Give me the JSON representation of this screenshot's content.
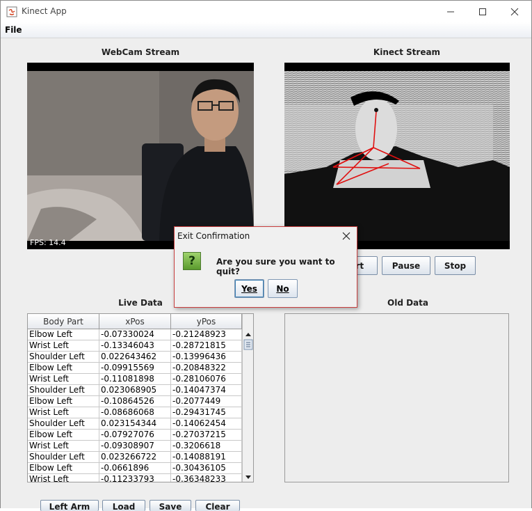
{
  "window": {
    "title": "Kinect App",
    "minimize_icon": "minimize-icon",
    "maximize_icon": "maximize-icon",
    "close_icon": "close-icon"
  },
  "menu": {
    "file": "File"
  },
  "webcam": {
    "caption": "WebCam Stream",
    "fps": "FPS: 14.4"
  },
  "kinect": {
    "caption": "Kinect Stream"
  },
  "controls": {
    "start": "Start",
    "pause": "Pause",
    "stop": "Stop"
  },
  "live_data": {
    "caption": "Live Data",
    "columns": [
      "Body Part",
      "xPos",
      "yPos"
    ],
    "rows": [
      [
        "Elbow Left",
        "-0.07330024",
        "-0.21248923"
      ],
      [
        "Wrist Left",
        "-0.13346043",
        "-0.28721815"
      ],
      [
        "Shoulder Left",
        "0.022643462",
        "-0.13996436"
      ],
      [
        "Elbow Left",
        "-0.09915569",
        "-0.20848322"
      ],
      [
        "Wrist Left",
        "-0.11081898",
        "-0.28106076"
      ],
      [
        "Shoulder Left",
        "0.023068905",
        "-0.14047374"
      ],
      [
        "Elbow Left",
        "-0.10864526",
        "-0.2077449"
      ],
      [
        "Wrist Left",
        "-0.08686068",
        "-0.29431745"
      ],
      [
        "Shoulder Left",
        "0.023154344",
        "-0.14062454"
      ],
      [
        "Elbow Left",
        "-0.07927076",
        "-0.27037215"
      ],
      [
        "Wrist Left",
        "-0.09308907",
        "-0.3206618"
      ],
      [
        "Shoulder Left",
        "0.023266722",
        "-0.14088191"
      ],
      [
        "Elbow Left",
        "-0.0661896",
        "-0.30436105"
      ],
      [
        "Wrist Left",
        "-0.11233793",
        "-0.36348233"
      ]
    ]
  },
  "old_data": {
    "caption": "Old Data"
  },
  "bottom_buttons": [
    "Left Arm",
    "Load",
    "Save",
    "Clear"
  ],
  "dialog": {
    "title": "Exit Confirmation",
    "message": "Are you sure you want to quit?",
    "icon": "question-icon",
    "yes": "Yes",
    "no": "No"
  },
  "colors": {
    "dialog_border": "#c83e3e",
    "button_border": "#7a8ea7",
    "skeleton": "#e01010"
  }
}
